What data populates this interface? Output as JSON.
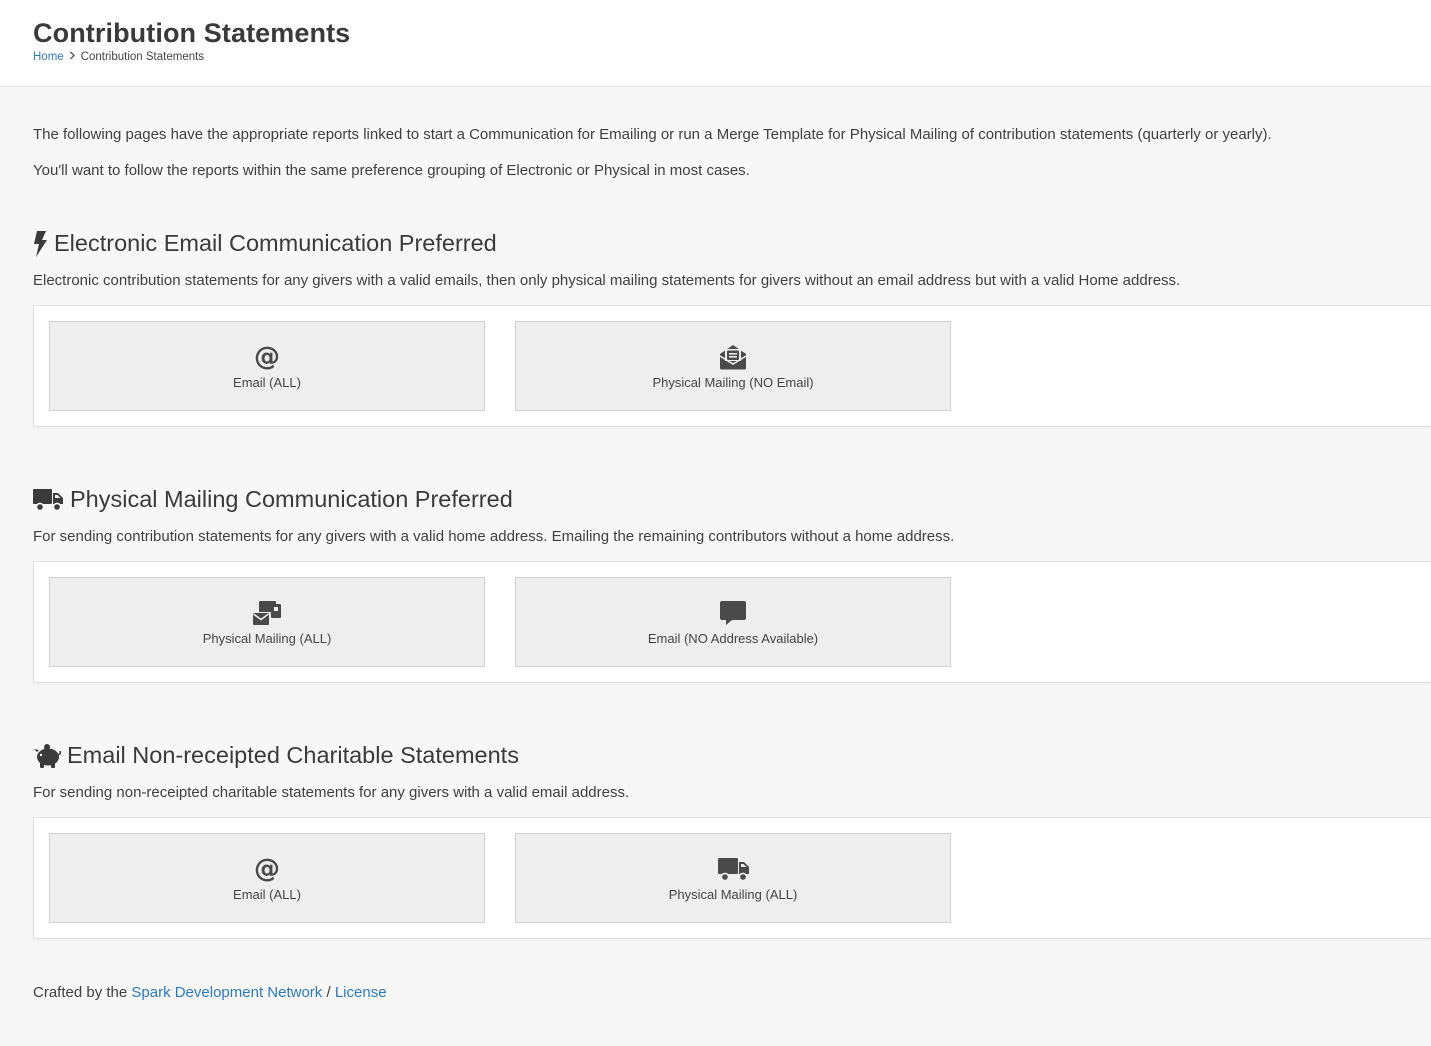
{
  "header": {
    "title": "Contribution Statements",
    "breadcrumb_home": "Home",
    "breadcrumb_current": "Contribution Statements"
  },
  "intro": {
    "line1": "The following pages have the appropriate reports linked to start a Communication for Emailing or run a Merge Template for Physical Mailing of contribution statements (quarterly or yearly).",
    "line2": "You'll want to follow the reports within the same preference grouping of Electronic or Physical in most cases."
  },
  "sections": [
    {
      "title": "Electronic Email Communication Preferred",
      "icon": "bolt-icon",
      "description": "Electronic contribution statements for any givers with a valid emails, then only physical mailing statements for givers without an email address but with a valid Home address.",
      "tiles": [
        {
          "label": "Email (ALL)",
          "icon": "at-icon"
        },
        {
          "label": "Physical Mailing (NO Email)",
          "icon": "envelope-open-text-icon"
        }
      ]
    },
    {
      "title": "Physical Mailing Communication Preferred",
      "icon": "truck-icon",
      "description": "For sending contribution statements for any givers with a valid home address. Emailing the remaining contributors without a home address.",
      "tiles": [
        {
          "label": "Physical Mailing (ALL)",
          "icon": "mail-bulk-icon"
        },
        {
          "label": "Email (NO Address Available)",
          "icon": "comment-icon"
        }
      ]
    },
    {
      "title": "Email Non-receipted Charitable Statements",
      "icon": "piggy-bank-icon",
      "description": "For sending non-receipted charitable statements for any givers with a valid email address.",
      "tiles": [
        {
          "label": "Email (ALL)",
          "icon": "at-icon"
        },
        {
          "label": "Physical Mailing (ALL)",
          "icon": "truck-icon"
        }
      ]
    }
  ],
  "footer": {
    "prefix": "Crafted by the",
    "link1": "Spark Development Network",
    "sep": "/",
    "link2": "License"
  },
  "colors": {
    "link": "#2c7ac1",
    "tile_bg": "#eeeeee",
    "icon": "#4a4a4a",
    "page_bg": "#f7f7f7"
  }
}
